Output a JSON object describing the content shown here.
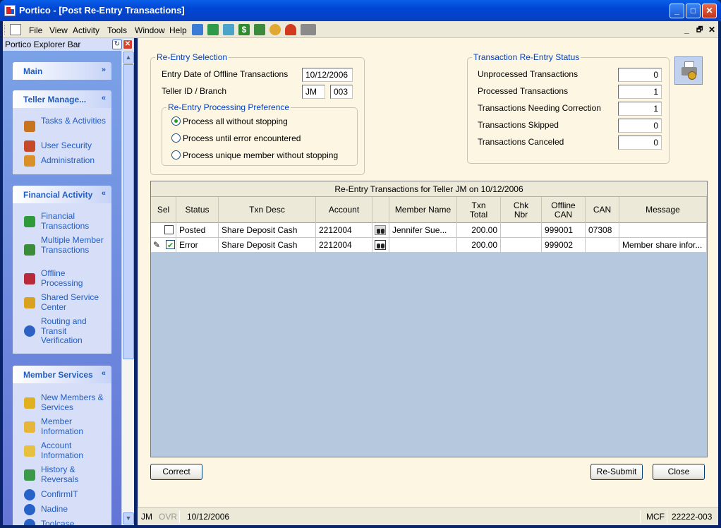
{
  "window": {
    "title": "Portico - [Post Re-Entry Transactions]",
    "min": "_",
    "max": "□",
    "close": "✕"
  },
  "menu": {
    "items": [
      "File",
      "View",
      "Activity",
      "Tools",
      "Window",
      "Help"
    ],
    "mdi_min": "_",
    "mdi_restore": "🗗",
    "mdi_close": "✕",
    "toolbar_icons": [
      "members-icon",
      "transfer-icon",
      "card-icon",
      "dollar-icon",
      "cash-icon",
      "bag-icon",
      "redo-icon",
      "printer-icon"
    ]
  },
  "explorer": {
    "title": "Portico Explorer Bar",
    "sections": [
      {
        "title": "Main",
        "chevron": "»",
        "items": []
      },
      {
        "title": "Teller Manage...",
        "chevron": "«",
        "items": [
          {
            "label": "Tasks & Activities",
            "icon": "tasks-icon",
            "color": "#c8731e"
          },
          {
            "label": "User Security",
            "icon": "users-icon",
            "color": "#c44a2a"
          },
          {
            "label": "Administration",
            "icon": "admin-icon",
            "color": "#d9902a"
          }
        ]
      },
      {
        "title": "Financial Activity",
        "chevron": "«",
        "items": [
          {
            "label": "Financial Transactions",
            "icon": "financial-icon",
            "color": "#2e9a3a"
          },
          {
            "label": "Multiple Member Transactions",
            "icon": "multiple-members-icon",
            "color": "#3a8b3a"
          },
          {
            "label": "Offline Processing",
            "icon": "offline-icon",
            "color": "#b82a3a"
          },
          {
            "label": "Shared Service Center",
            "icon": "shared-service-icon",
            "color": "#d8a21e"
          },
          {
            "label": "Routing and Transit Verification",
            "icon": "routing-icon",
            "color": "#2b62c4"
          }
        ]
      },
      {
        "title": "Member Services",
        "chevron": "«",
        "items": [
          {
            "label": "New Members & Services",
            "icon": "new-members-icon",
            "color": "#e0b020"
          },
          {
            "label": "Member Information",
            "icon": "member-info-icon",
            "color": "#e6b53a"
          },
          {
            "label": "Account Information",
            "icon": "account-info-icon",
            "color": "#e8c040"
          },
          {
            "label": "History & Reversals",
            "icon": "history-icon",
            "color": "#3a9a4a"
          },
          {
            "label": "ConfirmIT",
            "icon": "globe-icon",
            "color": "#2662c8"
          },
          {
            "label": "Nadine",
            "icon": "globe-icon",
            "color": "#2662c8"
          },
          {
            "label": "Toolcase",
            "icon": "globe-icon",
            "color": "#2662c8"
          }
        ]
      }
    ]
  },
  "selection": {
    "legend": "Re-Entry Selection",
    "entry_date_label": "Entry Date of Offline Transactions",
    "entry_date": "10/12/2006",
    "teller_label": "Teller ID / Branch",
    "teller_id": "JM",
    "branch": "003",
    "pref_legend": "Re-Entry Processing Preference",
    "options": [
      {
        "label": "Process all without stopping",
        "selected": true
      },
      {
        "label": "Process until error encountered",
        "selected": false
      },
      {
        "label": "Process unique member without stopping",
        "selected": false
      }
    ]
  },
  "status": {
    "legend": "Transaction Re-Entry Status",
    "rows": [
      {
        "label": "Unprocessed Transactions",
        "value": "0"
      },
      {
        "label": "Processed Transactions",
        "value": "1"
      },
      {
        "label": "Transactions Needing Correction",
        "value": "1"
      },
      {
        "label": "Transactions Skipped",
        "value": "0"
      },
      {
        "label": "Transactions Canceled",
        "value": "0"
      }
    ]
  },
  "grid": {
    "caption": "Re-Entry Transactions for Teller JM on 10/12/2006",
    "columns": [
      "Sel",
      "Status",
      "Txn Desc",
      "Account",
      "",
      "Member Name",
      "Txn Total",
      "Chk Nbr",
      "Offline CAN",
      "CAN",
      "Message"
    ],
    "rows": [
      {
        "selected": false,
        "editing": false,
        "status": "Posted",
        "txn_desc": "Share Deposit Cash",
        "account": "2212004",
        "member_name": "Jennifer Sue...",
        "txn_total": "200.00",
        "chk_nbr": "",
        "offline_can": "999001",
        "can": "07308",
        "message": ""
      },
      {
        "selected": true,
        "editing": true,
        "status": "Error",
        "txn_desc": "Share Deposit Cash",
        "account": "2212004",
        "member_name": "",
        "txn_total": "200.00",
        "chk_nbr": "",
        "offline_can": "999002",
        "can": "",
        "message": "Member share infor..."
      }
    ]
  },
  "buttons": {
    "correct": "Correct",
    "resubmit": "Re-Submit",
    "close": "Close"
  },
  "statusbar": {
    "user": "JM",
    "ovr": "OVR",
    "date": "10/12/2006",
    "mcf": "MCF",
    "code": "22222-003"
  }
}
